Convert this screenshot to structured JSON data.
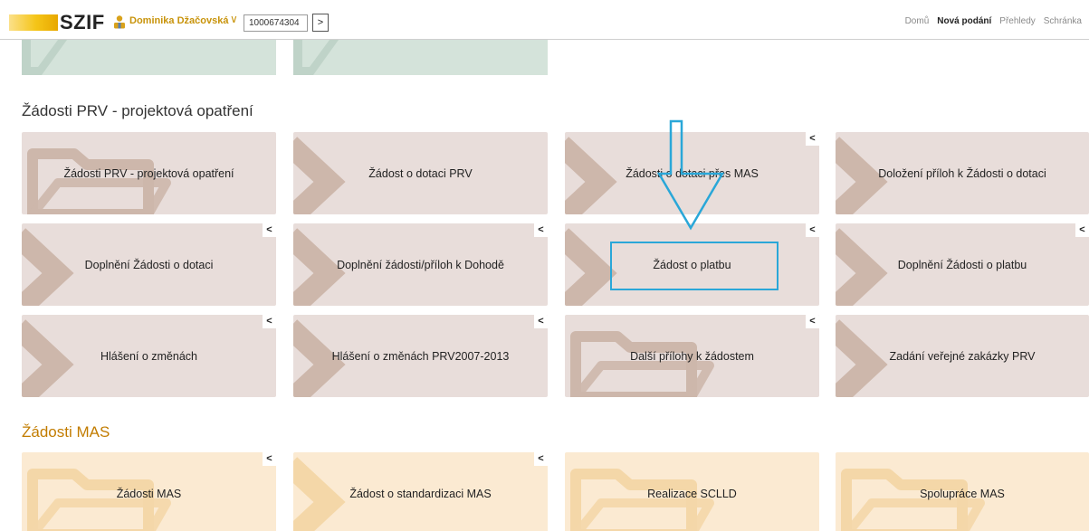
{
  "header": {
    "logo": "SZIF",
    "user_name": "Dominika Džačovská",
    "id_value": "1000674304",
    "go_label": ">",
    "nav": [
      {
        "label": "Domů",
        "active": false
      },
      {
        "label": "Nová podání",
        "active": true
      },
      {
        "label": "Přehledy",
        "active": false
      },
      {
        "label": "Schránka",
        "active": false
      }
    ]
  },
  "sections": {
    "prv": {
      "title": "Žádosti PRV - projektová opatření",
      "tiles": [
        {
          "label": "Žádosti PRV - projektová opatření",
          "corner": "",
          "deco": "folder"
        },
        {
          "label": "Žádost o dotaci PRV",
          "corner": "",
          "deco": "chevron"
        },
        {
          "label": "Žádosti o dotaci přes MAS",
          "corner": "<",
          "deco": "chevron"
        },
        {
          "label": "Doložení příloh k Žádosti o dotaci",
          "corner": "",
          "deco": "chevron"
        },
        {
          "label": "Doplnění Žádosti o dotaci",
          "corner": "<",
          "deco": "chevron"
        },
        {
          "label": "Doplnění žádosti/příloh k Dohodě",
          "corner": "<",
          "deco": "chevron"
        },
        {
          "label": "Žádost o platbu",
          "corner": "<",
          "deco": "chevron"
        },
        {
          "label": "Doplnění Žádosti o platbu",
          "corner": "<",
          "deco": "chevron"
        },
        {
          "label": "Hlášení o změnách",
          "corner": "<",
          "deco": "chevron"
        },
        {
          "label": "Hlášení o změnách PRV2007-2013",
          "corner": "<",
          "deco": "chevron"
        },
        {
          "label": "Další přílohy k žádostem",
          "corner": "<",
          "deco": "folder"
        },
        {
          "label": "Zadání veřejné zakázky PRV",
          "corner": "",
          "deco": "chevron"
        }
      ]
    },
    "mas": {
      "title": "Žádosti MAS",
      "tiles": [
        {
          "label": "Žádosti MAS",
          "corner": "<",
          "deco": "folder"
        },
        {
          "label": "Žádost o standardizaci MAS",
          "corner": "<",
          "deco": "chevron"
        },
        {
          "label": "Realizace SCLLD",
          "corner": "",
          "deco": "folder"
        },
        {
          "label": "Spolupráce MAS",
          "corner": "",
          "deco": "folder"
        }
      ]
    }
  },
  "colors": {
    "prv_tile": "#e8ddda",
    "mas_tile": "#fbead2",
    "prv_deco": "#cdb7ab",
    "mas_deco": "#f4d7a8",
    "annotation": "#2aa7d8",
    "accent": "#c8930a"
  }
}
